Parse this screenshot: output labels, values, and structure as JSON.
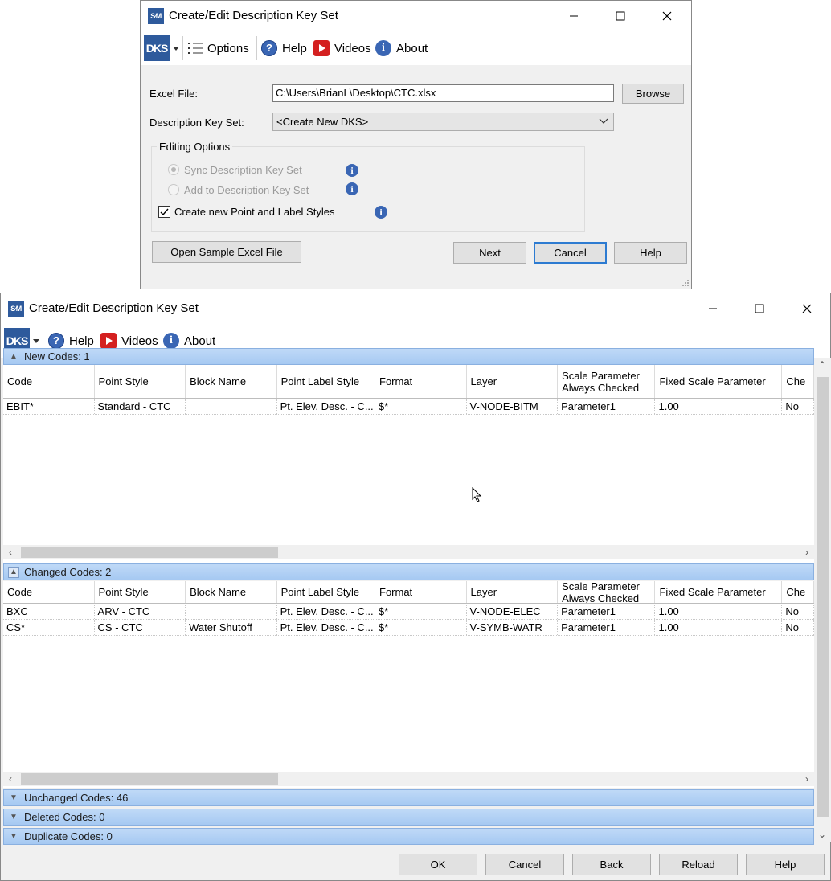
{
  "dialog1": {
    "title": "Create/Edit Description Key Set",
    "app_icon_text": "S∕M",
    "toolbar": {
      "logo_text": "DKS",
      "options": "Options",
      "help": "Help",
      "videos": "Videos",
      "about": "About"
    },
    "excel_file_label": "Excel File:",
    "excel_file_value": "C:\\Users\\BrianL\\Desktop\\CTC.xlsx",
    "browse": "Browse",
    "dks_label": "Description Key Set:",
    "dks_value": "<Create New DKS>",
    "editing_options": "Editing Options",
    "sync_label": "Sync Description Key Set",
    "add_label": "Add to Description Key Set",
    "create_label": "Create new Point and Label Styles",
    "open_sample": "Open Sample Excel File",
    "next": "Next",
    "cancel": "Cancel",
    "help_btn": "Help"
  },
  "dialog2": {
    "title": "Create/Edit Description Key Set",
    "app_icon_text": "S∕M",
    "toolbar": {
      "logo_text": "DKS",
      "help": "Help",
      "videos": "Videos",
      "about": "About"
    },
    "columns": [
      "Code",
      "Point Style",
      "Block Name",
      "Point Label Style",
      "Format",
      "Layer",
      "Scale Parameter Always Checked",
      "Fixed Scale Parameter",
      "Che"
    ],
    "new_codes_label": "New Codes: 1",
    "new_rows": [
      [
        "EBIT*",
        "Standard - CTC",
        "",
        "Pt. Elev. Desc. - C...",
        "$*",
        "V-NODE-BITM",
        "Parameter1",
        "1.00",
        "No"
      ]
    ],
    "changed_codes_label": "Changed Codes: 2",
    "changed_rows": [
      [
        "BXC",
        "ARV - CTC",
        "",
        "Pt. Elev. Desc. - C...",
        "$*",
        "V-NODE-ELEC",
        "Parameter1",
        "1.00",
        "No"
      ],
      [
        "CS*",
        "CS - CTC",
        "Water Shutoff",
        "Pt. Elev. Desc. - C...",
        "$*",
        "V-SYMB-WATR",
        "Parameter1",
        "1.00",
        "No"
      ]
    ],
    "unchanged_codes_label": "Unchanged Codes: 46",
    "deleted_codes_label": "Deleted Codes: 0",
    "duplicate_codes_label": "Duplicate Codes: 0",
    "ok": "OK",
    "cancel": "Cancel",
    "back": "Back",
    "reload": "Reload",
    "help_btn": "Help"
  }
}
